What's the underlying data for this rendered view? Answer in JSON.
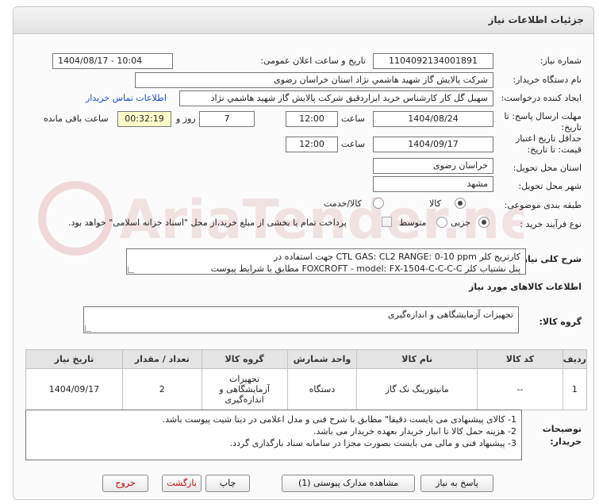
{
  "header": {
    "title": "جزئیات اطلاعات نیاز"
  },
  "need_number": {
    "label": "شماره نیاز:",
    "value": "1104092134001891"
  },
  "announce": {
    "label": "تاریخ و ساعت اعلان عمومی:",
    "value": "1404/08/17 - 10:04"
  },
  "buyer_org": {
    "label": "نام دستگاه خریدار:",
    "value": "شرکت پالایش گاز شهید هاشمي نژاد   استان خراسان رضوی"
  },
  "requester": {
    "label": "ایجاد کننده درخواست:",
    "value": "سهیل گل کار کارشناس خرید ابزاردقیق شرکت پالایش گاز شهید هاشمي نژاد",
    "contact_link": "اطلاعات تماس خریدار"
  },
  "deadline": {
    "label_line1": "مهلت ارسال پاسخ: تا",
    "label_line2": "تاریخ:",
    "date": "1404/08/24",
    "time_label": "ساعت",
    "time": "12:00",
    "days": "7",
    "days_label": "روز و",
    "remaining": "00:32:19",
    "remaining_label": "ساعت باقی مانده"
  },
  "validity": {
    "label_line1": "حداقل تاریخ اعتبار",
    "label_line2": "قیمت: تا تاریخ:",
    "date": "1404/09/17",
    "time_label": "ساعت",
    "time": "12:00"
  },
  "province": {
    "label": "استان محل تحویل:",
    "value": "خراسان رضوی"
  },
  "city": {
    "label": "شهر محل تحویل:",
    "value": "مشهد"
  },
  "category": {
    "label": "طبقه بندی موضوعی:",
    "options": [
      "کالا",
      "کالا/خدمت"
    ],
    "selected": "کالا"
  },
  "process": {
    "label": "نوع فرآیند خرید :",
    "options": [
      "جزیی",
      "متوسط"
    ],
    "selected": "جزیی",
    "payment_note": "پرداخت تمام یا بخشی از مبلغ خرید،از محل \"اسناد خزانه اسلامی\" خواهد بود."
  },
  "description": {
    "label": "شرح کلی نیاز:",
    "line1": "کارتریج کلر CTL GAS: CL2 RANGE: 0-10 ppm جهت استفاده در",
    "line2": "پنل نشتیاب کلر FOXCROFT - model: FX-1504-C-C-C-C مطابق با شرایط پیوست"
  },
  "goods_info": {
    "title": "اطلاعات کالاهای مورد نیاز"
  },
  "goods_group": {
    "label": "گروه کالا:",
    "value": "تجهیزات آزمایشگاهی و اندازه‌گیری"
  },
  "table": {
    "headers": [
      "ردیف",
      "کد کالا",
      "نام کالا",
      "واحد شمارش",
      "تعداد / مقدار",
      "تاریخ نیاز"
    ],
    "rows": [
      {
        "index": "1",
        "code": "--",
        "name": "مانیتورینگ نک گاز",
        "unit": "دستگاه",
        "qty": "2",
        "date": "1404/09/17",
        "group_line1": "تجهیزات",
        "group_line2": "آزمایشگاهی و",
        "group_line3": "اندازه‌گیری"
      }
    ],
    "group_header": "گروه کالا"
  },
  "buyer_notes": {
    "label_line1": "توضیحات",
    "label_line2": "خریدار:",
    "lines": [
      "1-    کالای پیشنهادی می بایست دقیقا\" مطابق با شرح فنی و مدل اعلامی در دیتا شیت پیوست باشد.",
      "2-    هزینه حمل کالا تا انبار خریدار بعهده خریدار می باشد.",
      "3-    پیشنهاد فنی و مالی می بایست بصورت مجزا در سامانه ستاد بارگذاری گردد."
    ]
  },
  "buttons": {
    "reply": "پاسخ به نیاز",
    "attachments": "مشاهده مدارک پیوستی (1)",
    "print": "چاپ",
    "back": "بازگشت",
    "exit": "خروج"
  },
  "colors": {
    "link": "#1a4fc4",
    "timer_bg": "#ffffcc",
    "exit_text": "#c00000"
  }
}
